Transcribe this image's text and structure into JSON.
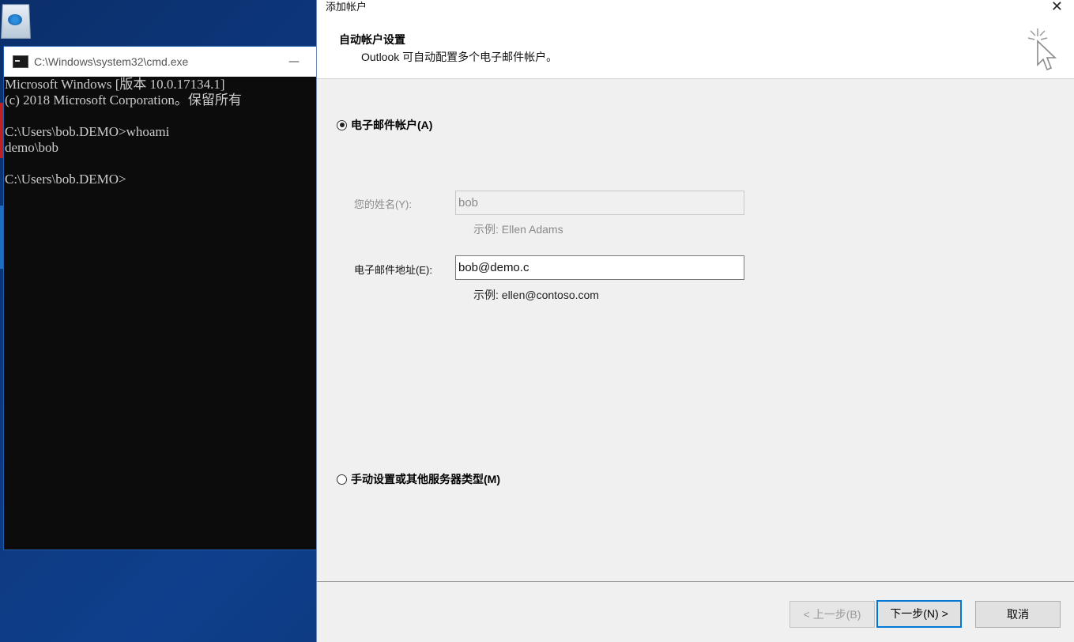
{
  "cmd": {
    "title": "C:\\Windows\\system32\\cmd.exe",
    "minimize_glyph": "—",
    "output": "Microsoft Windows [版本 10.0.17134.1]\n(c) 2018 Microsoft Corporation。保留所有\n\nC:\\Users\\bob.DEMO>whoami\ndemo\\bob\n\nC:\\Users\\bob.DEMO>"
  },
  "dialog": {
    "title": "添加帐户",
    "close_glyph": "✕",
    "header": {
      "title": "自动帐户设置",
      "subtitle": "Outlook 可自动配置多个电子邮件帐户。"
    },
    "email_account_option": {
      "label": "电子邮件帐户(A)",
      "checked": true
    },
    "name_field": {
      "label": "您的姓名(Y):",
      "value": "bob",
      "example": "示例: Ellen Adams"
    },
    "email_field": {
      "label": "电子邮件地址(E):",
      "value": "bob@demo.c",
      "example": "示例: ellen@contoso.com"
    },
    "manual_option": {
      "label": "手动设置或其他服务器类型(M)",
      "checked": false
    },
    "buttons": {
      "back": "< 上一步(B)",
      "next": "下一步(N) >",
      "cancel": "取消"
    }
  }
}
